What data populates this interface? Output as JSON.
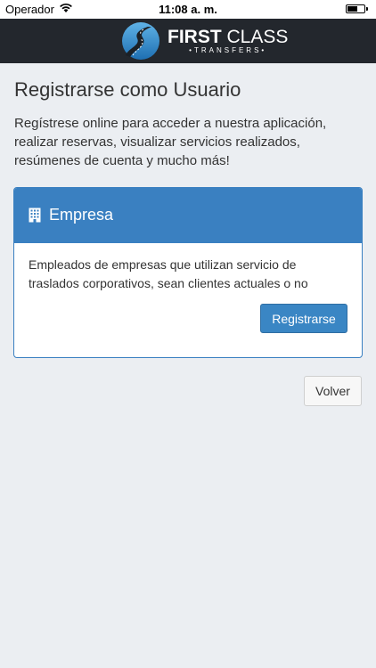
{
  "status_bar": {
    "carrier": "Operador",
    "time": "11:08 a. m.",
    "battery_level": 0.6
  },
  "header": {
    "logo": {
      "brand_bold": "FIRST",
      "brand_light": "CLASS",
      "tagline": "•TRANSFERS•"
    }
  },
  "page": {
    "title": "Registrarse como Usuario",
    "intro": "Regístrese online para acceder a nuestra aplicación, realizar reservas, visualizar servicios realizados, resúmenes de cuenta y mucho más!"
  },
  "panel": {
    "title": "Empresa",
    "icon": "building-icon",
    "description": "Empleados de empresas que utilizan servicio de traslados corporativos, sean clientes actuales o no",
    "button_label": "Registrarse"
  },
  "footer": {
    "back_label": "Volver"
  },
  "colors": {
    "primary": "#3a80c1",
    "navbar": "#23272d",
    "background": "#ebeef2"
  }
}
